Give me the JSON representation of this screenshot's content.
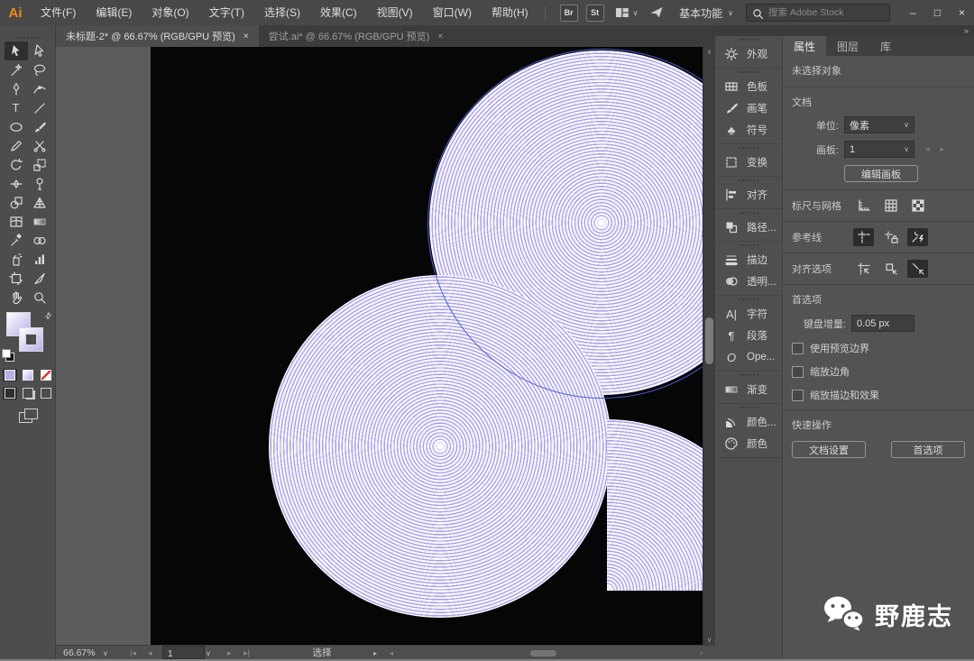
{
  "menu": {
    "logo": "Ai",
    "items": [
      "文件(F)",
      "编辑(E)",
      "对象(O)",
      "文字(T)",
      "选择(S)",
      "效果(C)",
      "视图(V)",
      "窗口(W)",
      "帮助(H)"
    ]
  },
  "topbar": {
    "br": "Br",
    "st": "St",
    "workspace": "基本功能",
    "search_placeholder": "搜索 Adobe Stock"
  },
  "window": {
    "minimize": "–",
    "maximize": "□",
    "close": "×"
  },
  "tabs": [
    {
      "title": "未标题-2* @ 66.67% (RGB/GPU 预览)",
      "close": "×",
      "active": true
    },
    {
      "title": "尝试.ai* @ 66.67% (RGB/GPU 预览)",
      "close": "×",
      "active": false
    }
  ],
  "toolbar": {
    "tools": [
      "selection",
      "direct-selection",
      "magic-wand",
      "lasso",
      "pen",
      "curvature",
      "type",
      "line-segment",
      "ellipse",
      "paintbrush",
      "shaper",
      "scissors",
      "rotate",
      "scale",
      "width",
      "puppet-warp",
      "shape-builder",
      "perspective-grid",
      "mesh",
      "gradient",
      "eyedropper",
      "blend",
      "symbol-sprayer",
      "column-graph",
      "artboard",
      "slice",
      "hand",
      "zoom"
    ]
  },
  "panels": {
    "collapse": "»",
    "items": [
      "外观",
      "色板",
      "画笔",
      "符号",
      "变换",
      "对齐",
      "路径...",
      "描边",
      "透明...",
      "字符",
      "段落",
      "Ope...",
      "渐变",
      "颜色...",
      "颜色"
    ]
  },
  "properties": {
    "tabs": [
      "属性",
      "图层",
      "库"
    ],
    "no_selection": "未选择对象",
    "document": {
      "label": "文档",
      "unit_label": "单位:",
      "unit_value": "像素",
      "artboard_label": "画板:",
      "artboard_value": "1",
      "edit_artboard": "编辑画板"
    },
    "rulers_label": "标尺与网格",
    "guides_label": "参考线",
    "snap_label": "对齐选项",
    "preferences": {
      "label": "首选项",
      "keyboard_label": "键盘增量:",
      "keyboard_value": "0.05 px",
      "checkboxes": [
        "使用预览边界",
        "缩放边角",
        "缩放描边和效果"
      ]
    },
    "quick": {
      "label": "快速操作",
      "buttons": [
        "文档设置",
        "首选项"
      ]
    }
  },
  "statusbar": {
    "zoom": "66.67%",
    "artboard": "1",
    "status": "选择"
  },
  "glyphs": {
    "type_tool": "T",
    "symbols": "♣",
    "character": "A|",
    "paragraph": "¶",
    "opentype": "O",
    "swap": "⇄",
    "chevron_down": "∨",
    "chevron_up": "∧",
    "nav_first": "|◂",
    "nav_prev": "◂",
    "nav_next": "▸",
    "nav_last": "▸|",
    "panel_play_r": "▸",
    "panel_play_l": "◂",
    "scroll_right": "›"
  },
  "watermark": {
    "text": "野鹿志"
  },
  "colors": {
    "ring": "#a9a0e6",
    "ring_gap": "#f6f5fd",
    "selection_blue": "#4b5ed6",
    "artboard_bg": "#060606",
    "panel_bg": "#535353",
    "logo_orange": "#ef8f1c"
  }
}
